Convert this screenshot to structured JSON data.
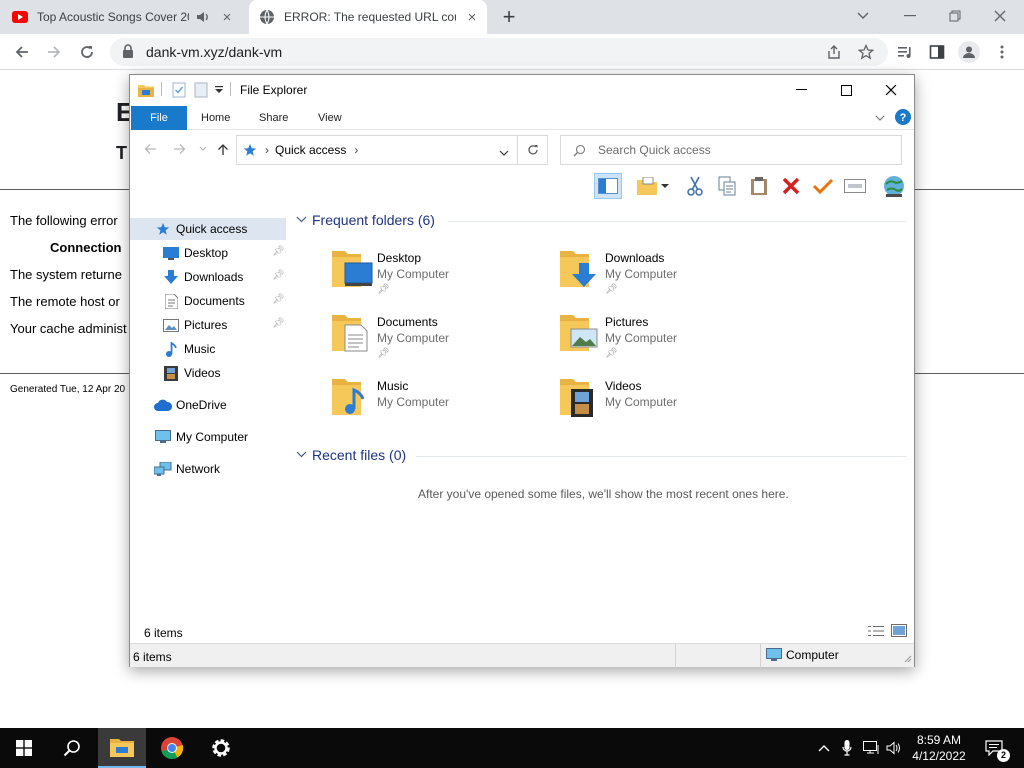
{
  "browser": {
    "tabs": [
      {
        "title": "Top Acoustic Songs Cover 20",
        "favicon": "youtube-icon",
        "muted_icon": "speaker-icon"
      },
      {
        "title": "ERROR: The requested URL coul",
        "favicon": "globe-icon"
      }
    ],
    "url": "dank-vm.xyz/dank-vm"
  },
  "webpage": {
    "heading": "E",
    "subheading": "T",
    "line1": "The following error",
    "line2": "Connection",
    "line3": "The system returne",
    "line4": "The remote host or",
    "line5": "Your cache administ",
    "generated": "Generated Tue, 12 Apr 20"
  },
  "explorer": {
    "title": "File Explorer",
    "ribbon_tabs": [
      "File",
      "Home",
      "Share",
      "View"
    ],
    "address": "Quick access",
    "search_placeholder": "Search Quick access",
    "nav": {
      "quick_access": "Quick access",
      "desktop": "Desktop",
      "downloads": "Downloads",
      "documents": "Documents",
      "pictures": "Pictures",
      "music": "Music",
      "videos": "Videos",
      "onedrive": "OneDrive",
      "my_computer": "My Computer",
      "network": "Network"
    },
    "frequent_header": "Frequent folders (6)",
    "folders": [
      {
        "name": "Desktop",
        "location": "My Computer"
      },
      {
        "name": "Downloads",
        "location": "My Computer"
      },
      {
        "name": "Documents",
        "location": "My Computer"
      },
      {
        "name": "Pictures",
        "location": "My Computer"
      },
      {
        "name": "Music",
        "location": "My Computer"
      },
      {
        "name": "Videos",
        "location": "My Computer"
      }
    ],
    "recent_header": "Recent files (0)",
    "recent_message": "After you've opened some files, we'll show the most recent ones here.",
    "item_count": "6 items",
    "status_count": "6 items",
    "status_location": "Computer"
  },
  "taskbar": {
    "time": "8:59 AM",
    "date": "4/12/2022",
    "notification_count": "2"
  },
  "colors": {
    "accent": "#1979ca",
    "folder": "#f6c859",
    "group_header": "#1e3287"
  }
}
